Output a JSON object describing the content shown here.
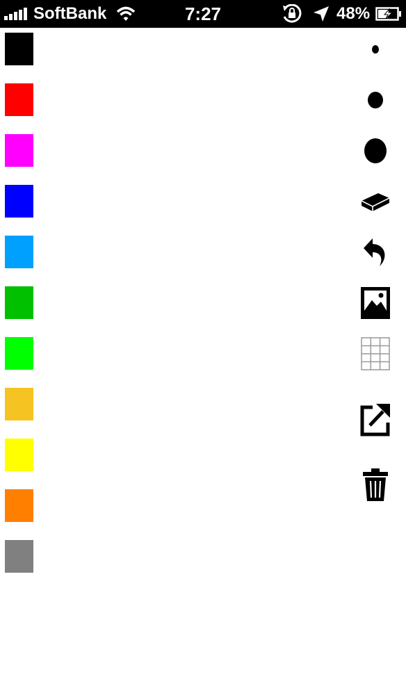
{
  "status_bar": {
    "carrier": "SoftBank",
    "time": "7:27",
    "battery_percent": "48%",
    "icons": [
      "signal-bars-icon",
      "wifi-icon",
      "rotation-lock-icon",
      "location-arrow-icon",
      "battery-charging-icon"
    ]
  },
  "palette": {
    "colors": [
      "#000000",
      "#ff0000",
      "#ff00ff",
      "#0000ff",
      "#00a0ff",
      "#00c000",
      "#00ff00",
      "#f5c322",
      "#ffff00",
      "#ff7f00",
      "#808080"
    ]
  },
  "tools": {
    "icons": [
      "brush-size-small-icon",
      "brush-size-medium-icon",
      "brush-size-large-icon",
      "eraser-icon",
      "undo-icon",
      "image-icon",
      "grid-icon",
      "share-icon",
      "trash-icon"
    ]
  }
}
